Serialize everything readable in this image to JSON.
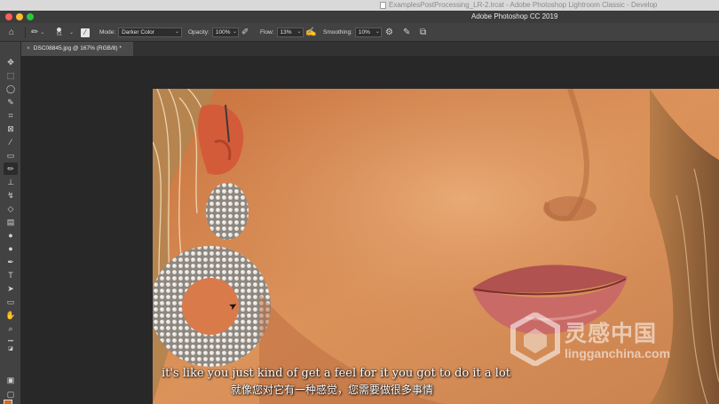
{
  "mac_bar": {
    "faint_title": "ExamplesPostProcessing_LR-2.lrcat - Adobe Photoshop Lightroom Classic - Develop"
  },
  "window": {
    "title": "Adobe Photoshop CC 2019"
  },
  "options": {
    "brush_size": "51",
    "mode_label": "Mode:",
    "mode_value": "Darker Color",
    "opacity_label": "Opacity:",
    "opacity_value": "100%",
    "flow_label": "Flow:",
    "flow_value": "13%",
    "smoothing_label": "Smoothing:",
    "smoothing_value": "10%"
  },
  "tab": {
    "close": "×",
    "label": "DSC08845.jpg @ 167% (RGB/8) *"
  },
  "tools": [
    {
      "name": "move-tool",
      "glyph": "✥"
    },
    {
      "name": "marquee-tool",
      "glyph": "⬚"
    },
    {
      "name": "lasso-tool",
      "glyph": "◯"
    },
    {
      "name": "quick-select-tool",
      "glyph": "✎"
    },
    {
      "name": "crop-tool",
      "glyph": "⌗"
    },
    {
      "name": "frame-tool",
      "glyph": "⊠"
    },
    {
      "name": "eyedropper-tool",
      "glyph": "⁄"
    },
    {
      "name": "healing-tool",
      "glyph": "▭"
    },
    {
      "name": "brush-tool",
      "glyph": "✏"
    },
    {
      "name": "stamp-tool",
      "glyph": "⊥"
    },
    {
      "name": "history-brush-tool",
      "glyph": "↯"
    },
    {
      "name": "eraser-tool",
      "glyph": "◇"
    },
    {
      "name": "gradient-tool",
      "glyph": "▤"
    },
    {
      "name": "blur-tool",
      "glyph": "●"
    },
    {
      "name": "dodge-tool",
      "glyph": "●"
    },
    {
      "name": "pen-tool",
      "glyph": "✒"
    },
    {
      "name": "type-tool",
      "glyph": "T"
    },
    {
      "name": "path-select-tool",
      "glyph": "➤"
    },
    {
      "name": "rectangle-tool",
      "glyph": "▭"
    },
    {
      "name": "hand-tool",
      "glyph": "✋"
    },
    {
      "name": "zoom-tool",
      "glyph": "⌕"
    },
    {
      "name": "more-tools",
      "glyph": "•••"
    }
  ],
  "subtitles": {
    "en": "it's like you just kind of get a feel for it you got to do it a lot",
    "cn": "就像您对它有一种感觉，您需要做很多事情"
  },
  "watermark": {
    "cn": "灵感中国",
    "url": "lingganchina.com"
  },
  "colors": {
    "foreground": "#d2691e",
    "background": "#b13b18",
    "accent_red": "#ff5f57"
  }
}
